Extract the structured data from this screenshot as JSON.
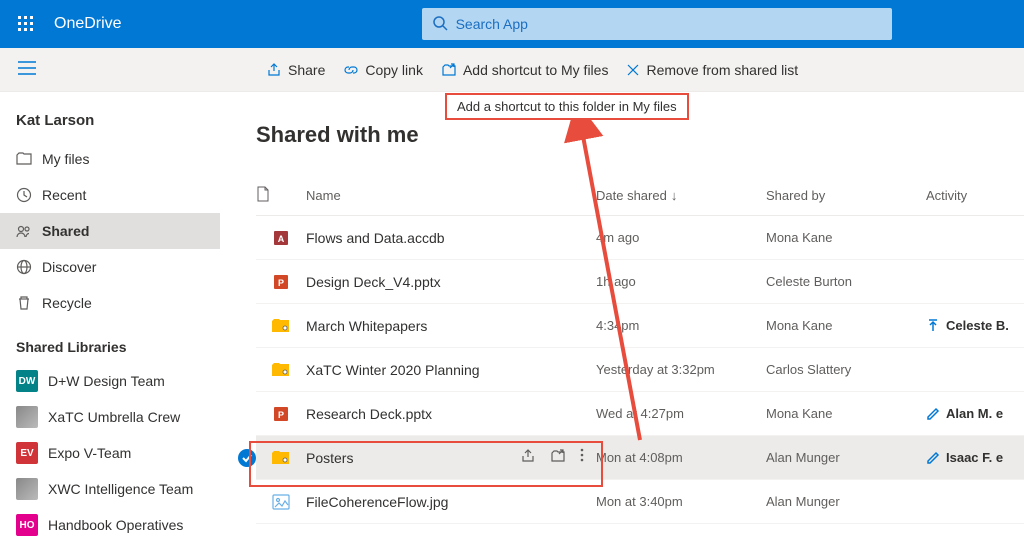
{
  "header": {
    "brand": "OneDrive",
    "searchPlaceholder": "Search App"
  },
  "cmdbar": {
    "share": "Share",
    "copylink": "Copy link",
    "shortcut": "Add shortcut to My files",
    "remove": "Remove from shared list"
  },
  "tooltip": "Add a shortcut to this folder in My files",
  "sidebar": {
    "user": "Kat Larson",
    "nav": [
      {
        "label": "My files"
      },
      {
        "label": "Recent"
      },
      {
        "label": "Shared"
      },
      {
        "label": "Discover"
      },
      {
        "label": "Recycle"
      }
    ],
    "librariesHead": "Shared Libraries",
    "libs": [
      {
        "abbr": "DW",
        "label": "D+W Design Team",
        "color": "#038387"
      },
      {
        "abbr": "",
        "label": "XaTC Umbrella Crew",
        "color": "#d13438",
        "img": true
      },
      {
        "abbr": "EV",
        "label": "Expo V-Team",
        "color": "#d13438"
      },
      {
        "abbr": "",
        "label": "XWC Intelligence Team",
        "color": "#498205",
        "img": true
      },
      {
        "abbr": "HO",
        "label": "Handbook Operatives",
        "color": "#e3008c"
      }
    ]
  },
  "page": {
    "title": "Shared with me"
  },
  "columns": {
    "name": "Name",
    "date": "Date shared",
    "shared": "Shared by",
    "activity": "Activity"
  },
  "rows": [
    {
      "icon": "access",
      "name": "Flows and Data.accdb",
      "date": "4m ago",
      "shared": "Mona Kane",
      "activity": ""
    },
    {
      "icon": "ppt",
      "name": "Design Deck_V4.pptx",
      "date": "1h ago",
      "shared": "Celeste Burton",
      "activity": ""
    },
    {
      "icon": "folder-shared",
      "name": "March Whitepapers",
      "date": "4:34pm",
      "shared": "Mona Kane",
      "activity": "Celeste B.",
      "actIcon": "upload"
    },
    {
      "icon": "folder-shared",
      "name": "XaTC Winter 2020 Planning",
      "date": "Yesterday at 3:32pm",
      "shared": "Carlos Slattery",
      "activity": ""
    },
    {
      "icon": "ppt",
      "name": "Research Deck.pptx",
      "date": "Wed at 4:27pm",
      "shared": "Mona Kane",
      "activity": "Alan M. e",
      "actIcon": "edit"
    },
    {
      "icon": "folder-shared",
      "name": "Posters",
      "date": "Mon at 4:08pm",
      "shared": "Alan Munger",
      "activity": "Isaac F. e",
      "actIcon": "edit",
      "selected": true
    },
    {
      "icon": "image",
      "name": "FileCoherenceFlow.jpg",
      "date": "Mon at 3:40pm",
      "shared": "Alan Munger",
      "activity": ""
    }
  ]
}
